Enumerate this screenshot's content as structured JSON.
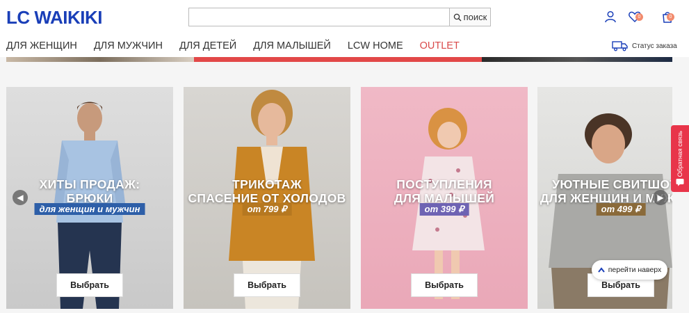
{
  "header": {
    "logo": "LC WAIKIKI",
    "search": {
      "placeholder": "",
      "button_label": "поиск"
    },
    "favorites_count": "0",
    "cart_count": "0"
  },
  "nav": {
    "items": [
      "ДЛЯ ЖЕНЩИН",
      "ДЛЯ МУЖЧИН",
      "ДЛЯ ДЕТЕЙ",
      "ДЛЯ МАЛЫШЕЙ",
      "LCW HOME",
      "OUTLET"
    ],
    "order_status": "Статус заказа"
  },
  "cards": [
    {
      "title1": "ХИТЫ ПРОДАЖ:",
      "title2": "БРЮКИ",
      "tag": "для женщин и мужчин",
      "tag_color": "#2e5fa8",
      "button": "Выбрать"
    },
    {
      "title1": "ТРИКОТАЖ",
      "title2": "СПАСЕНИЕ ОТ ХОЛОДОВ",
      "tag": "от 799 ₽",
      "tag_color": "#b67820",
      "button": "Выбрать"
    },
    {
      "title1": "ПОСТУПЛЕНИЯ",
      "title2": "ДЛЯ МАЛЫШЕЙ",
      "tag": "от 399 ₽",
      "tag_color": "#6e63b3",
      "button": "Выбрать"
    },
    {
      "title1": "УЮТНЫЕ СВИТШОТЫ",
      "title2": "ДЛЯ ЖЕНЩИН И МУЖЧИН",
      "tag": "от 499 ₽",
      "tag_color": "#8a6a3a",
      "button": "Выбрать"
    }
  ],
  "feedback_label": "Обратная связь",
  "back_to_top": "перейти наверх",
  "colors": {
    "brand": "#1a3fb8",
    "outlet": "#d94a4a",
    "feedback": "#e8354a"
  }
}
